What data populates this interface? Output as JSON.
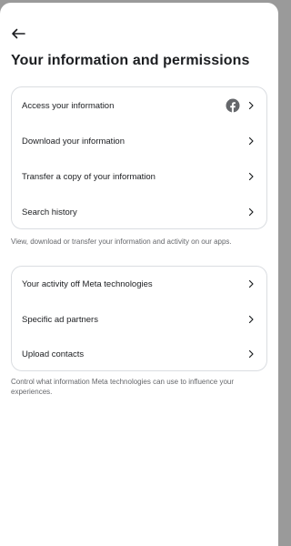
{
  "header": {
    "back_icon": "arrow-left-icon",
    "title": "Your information and permissions"
  },
  "section1": {
    "items": [
      {
        "label": "Access your information",
        "icon": "facebook-icon"
      },
      {
        "label": "Download your information"
      },
      {
        "label": "Transfer a copy of your information"
      },
      {
        "label": "Search history"
      }
    ],
    "caption": "View, download or transfer your information and activity on our apps."
  },
  "section2": {
    "items": [
      {
        "label": "Your activity off Meta technologies"
      },
      {
        "label": "Specific ad partners"
      },
      {
        "label": "Upload contacts"
      }
    ],
    "caption": "Control what information Meta technologies can use to influence your experiences."
  },
  "colors": {
    "facebook_icon": "#65676b",
    "border": "#dadde1",
    "caption_text": "#65676b"
  }
}
